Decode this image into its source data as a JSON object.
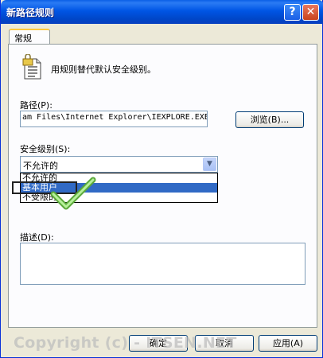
{
  "window": {
    "title": "新路径规则",
    "help_label": "?",
    "close_label": "✕"
  },
  "tab": {
    "label": "常规"
  },
  "intro_text": "用规则替代默认安全级别。",
  "path": {
    "label": "路径(P):",
    "value": "am Files\\Internet Explorer\\IEXPLORE.EXE",
    "browse_label": "浏览(B)..."
  },
  "security_level": {
    "label": "安全级别(S):",
    "selected": "不允许的",
    "options": [
      "不允许的",
      "基本用户",
      "不受限的"
    ],
    "highlighted_index": 1
  },
  "description": {
    "label": "描述(D):",
    "value": ""
  },
  "buttons": {
    "ok": "确定",
    "cancel": "取消",
    "apply": "应用(A)"
  },
  "watermark": "Copyright (c) - ITSEN.NET",
  "colors": {
    "title_blue": "#0055e5",
    "selection": "#316ac5",
    "check_green": "#7bd35a"
  }
}
